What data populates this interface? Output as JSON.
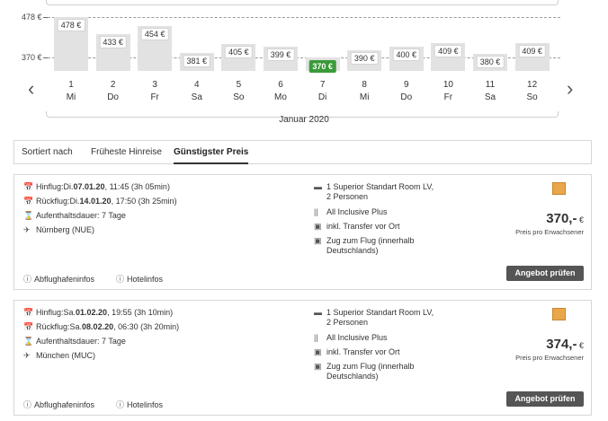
{
  "chart_data": {
    "type": "bar",
    "xlabel": "Januar 2020",
    "categories": [
      "1",
      "2",
      "3",
      "4",
      "5",
      "6",
      "7",
      "8",
      "9",
      "10",
      "11",
      "12"
    ],
    "weekdays": [
      "Mi",
      "Do",
      "Fr",
      "Sa",
      "So",
      "Mo",
      "Di",
      "Mi",
      "Do",
      "Fr",
      "Sa",
      "So"
    ],
    "values": [
      478,
      433,
      454,
      381,
      405,
      399,
      370,
      390,
      400,
      409,
      380,
      409
    ],
    "price_labels": [
      "478 €",
      "433 €",
      "454 €",
      "381 €",
      "405 €",
      "399 €",
      "370 €",
      "390 €",
      "400 €",
      "409 €",
      "380 €",
      "409 €"
    ],
    "selected_index": 6,
    "y_ref_lines": [
      478,
      370
    ],
    "y_ref_labels": [
      "478 €",
      "370 €"
    ],
    "bar_color": "#e2e2e2",
    "selected_color": "#3a9a3a"
  },
  "nav": {
    "prev_icon": "chevron-left-icon",
    "next_icon": "chevron-right-icon",
    "prev": "‹",
    "next": "›"
  },
  "sort": {
    "label": "Sortiert nach",
    "options": [
      "Früheste Hinreise",
      "Günstigster Preis"
    ],
    "active": "Günstigster Preis"
  },
  "offers": [
    {
      "outbound_label": "Hinflug: ",
      "outbound_day": "Di. ",
      "outbound_date": "07.01.20",
      "outbound_rest": ", 11:45 (3h 05min)",
      "return_label": "Rückflug: ",
      "return_day": "Di. ",
      "return_date": "14.01.20",
      "return_rest": ", 17:50 (3h 25min)",
      "stay": "Aufenthaltsdauer: 7 Tage",
      "airport": "Nürnberg (NUE)",
      "room": "1 Superior Standart Room LV,",
      "persons": "2 Personen",
      "board": "All Inclusive Plus",
      "transfer": "inkl. Transfer vor Ort",
      "train_1": "Zug zum Flug (innerhalb",
      "train_2": "Deutschlands)",
      "price": "370,-",
      "currency": "€",
      "price_note": "Preis pro Erwachsener",
      "button": "Angebot prüfen",
      "link_airport": "Abflughafeninfos",
      "link_hotel": "Hotelinfos"
    },
    {
      "outbound_label": "Hinflug: ",
      "outbound_day": "Sa. ",
      "outbound_date": "01.02.20",
      "outbound_rest": ", 19:55 (3h 10min)",
      "return_label": "Rückflug: ",
      "return_day": "Sa. ",
      "return_date": "08.02.20",
      "return_rest": ", 06:30 (3h 20min)",
      "stay": "Aufenthaltsdauer: 7 Tage",
      "airport": "München (MUC)",
      "room": "1 Superior Standart Room LV,",
      "persons": "2 Personen",
      "board": "All Inclusive Plus",
      "transfer": "inkl. Transfer vor Ort",
      "train_1": "Zug zum Flug (innerhalb",
      "train_2": "Deutschlands)",
      "price": "374,-",
      "currency": "€",
      "price_note": "Preis pro Erwachsener",
      "button": "Angebot prüfen",
      "link_airport": "Abflughafeninfos",
      "link_hotel": "Hotelinfos"
    }
  ]
}
